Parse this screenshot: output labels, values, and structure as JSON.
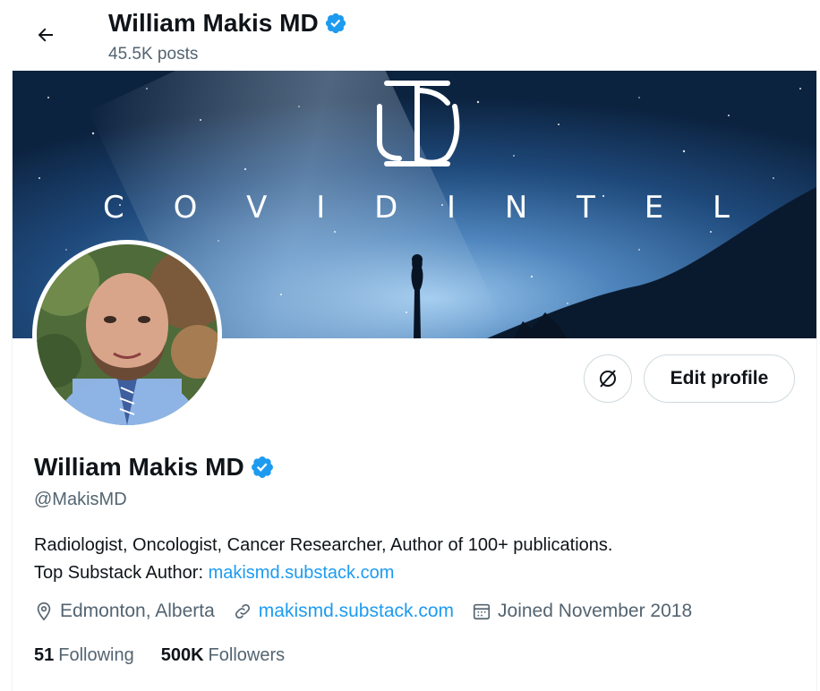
{
  "header": {
    "name": "William Makis MD",
    "posts": "45.5K posts"
  },
  "banner": {
    "logo_letters": "IC",
    "text": "C O V I D   I N T E L"
  },
  "profile": {
    "name": "William Makis MD",
    "handle": "@MakisMD",
    "bio_line1": "Radiologist, Oncologist, Cancer Researcher, Author of 100+ publications.",
    "bio_line2_prefix": "Top Substack Author: ",
    "bio_link": "makismd.substack.com",
    "location": "Edmonton, Alberta",
    "website": "makismd.substack.com",
    "joined": "Joined November 2018",
    "following_count": "51",
    "following_label": "Following",
    "followers_count": "500K",
    "followers_label": "Followers"
  },
  "buttons": {
    "edit_profile": "Edit profile"
  },
  "colors": {
    "accent": "#1d9bf0",
    "text": "#0f1419",
    "muted": "#536471",
    "border": "#cfd9de"
  },
  "icons": [
    "back-arrow-icon",
    "verified-badge-icon",
    "grok-icon",
    "location-icon",
    "link-icon",
    "calendar-icon"
  ]
}
